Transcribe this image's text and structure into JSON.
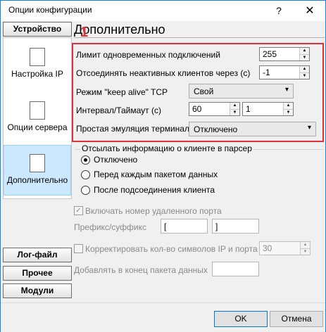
{
  "window": {
    "title": "Опции конфигурации",
    "help_glyph": "?",
    "close_glyph": "✕"
  },
  "nav": {
    "device_label": "Устройство",
    "items": [
      {
        "label": "Настройка IP",
        "icon": "ip-settings-icon"
      },
      {
        "label": "Опции сервера",
        "icon": "server-options-icon"
      },
      {
        "label": "Дополнительно",
        "icon": "advanced-icon"
      }
    ],
    "log_label": "Лог-файл",
    "misc_label": "Прочее",
    "modules_label": "Модули"
  },
  "panel": {
    "title": "Дополнительно",
    "annotation": "1",
    "conn_limit_label": "Лимит одновременных подключений",
    "conn_limit_value": "255",
    "disconnect_label": "Отсоединять неактивных клиентов через (с)",
    "disconnect_value": "-1",
    "keepalive_label": "Режим \"keep alive\" TCP",
    "keepalive_value": "Свой",
    "interval_label": "Интервал/Таймаут (с)",
    "interval_value": "60",
    "timeout_value": "1",
    "terminal_label": "Простая эмуляция терминала",
    "terminal_value": "Отключено",
    "send_info_title": "Отсылать информацию о клиенте в парсер",
    "radio_off": "Отключено",
    "radio_each": "Перед каждым пакетом данных",
    "radio_after": "После подсоединения клиента",
    "remote_port_label": "Включать номер удаленного порта",
    "prefix_label": "Префикс/суффикс",
    "prefix_value": "[",
    "suffix_value": "]",
    "correct_label": "Корректировать кол-во символов IP и порта",
    "correct_value": "30",
    "append_label": "Добавлять в конец пакета данных"
  },
  "footer": {
    "ok_label": "OK",
    "cancel_label": "Отмена"
  }
}
